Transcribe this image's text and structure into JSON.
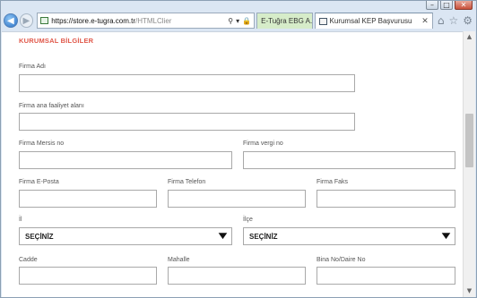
{
  "browser": {
    "address_url": "https://store.e-tugra.com.tr",
    "address_rest": "/HTMLClier",
    "tabs": [
      {
        "label": "E-Tuğra EBG A..."
      },
      {
        "label": "Kurumsal KEP Başvurusu"
      }
    ]
  },
  "form": {
    "section_title": "KURUMSAL BİLGİLER",
    "fields": {
      "firma_adi": {
        "label": "Firma Adı",
        "value": ""
      },
      "faaliyet": {
        "label": "Firma ana faaliyet alanı",
        "value": ""
      },
      "mersis": {
        "label": "Firma Mersis no",
        "value": ""
      },
      "vergi": {
        "label": "Firma vergi no",
        "value": ""
      },
      "eposta": {
        "label": "Firma E-Posta",
        "value": ""
      },
      "telefon": {
        "label": "Firma Telefon",
        "value": ""
      },
      "faks": {
        "label": "Firma Faks",
        "value": ""
      },
      "il": {
        "label": "İl",
        "selected": "SEÇİNİZ"
      },
      "ilce": {
        "label": "İlçe",
        "selected": "SEÇİNİZ"
      },
      "cadde": {
        "label": "Cadde",
        "value": ""
      },
      "mahalle": {
        "label": "Mahalle",
        "value": ""
      },
      "bina": {
        "label": "Bina No/Daire No",
        "value": ""
      }
    }
  }
}
